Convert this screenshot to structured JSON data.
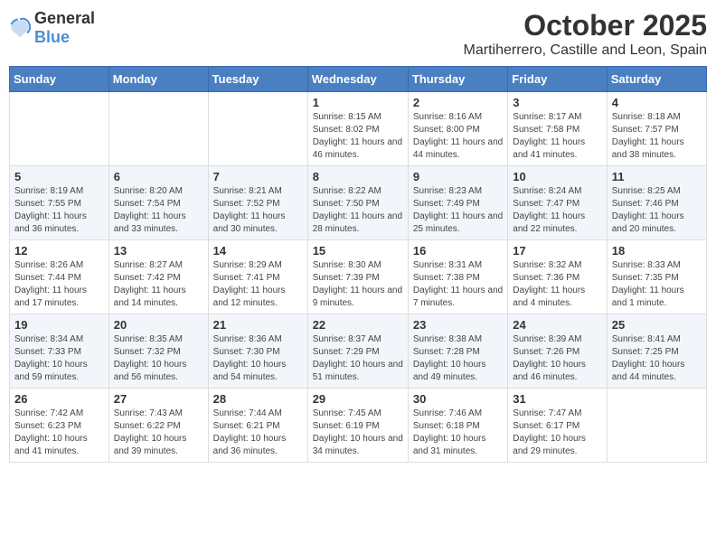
{
  "logo": {
    "general": "General",
    "blue": "Blue"
  },
  "header": {
    "month": "October 2025",
    "location": "Martiherrero, Castille and Leon, Spain"
  },
  "weekdays": [
    "Sunday",
    "Monday",
    "Tuesday",
    "Wednesday",
    "Thursday",
    "Friday",
    "Saturday"
  ],
  "weeks": [
    [
      {
        "day": "",
        "info": ""
      },
      {
        "day": "",
        "info": ""
      },
      {
        "day": "",
        "info": ""
      },
      {
        "day": "1",
        "info": "Sunrise: 8:15 AM\nSunset: 8:02 PM\nDaylight: 11 hours and 46 minutes."
      },
      {
        "day": "2",
        "info": "Sunrise: 8:16 AM\nSunset: 8:00 PM\nDaylight: 11 hours and 44 minutes."
      },
      {
        "day": "3",
        "info": "Sunrise: 8:17 AM\nSunset: 7:58 PM\nDaylight: 11 hours and 41 minutes."
      },
      {
        "day": "4",
        "info": "Sunrise: 8:18 AM\nSunset: 7:57 PM\nDaylight: 11 hours and 38 minutes."
      }
    ],
    [
      {
        "day": "5",
        "info": "Sunrise: 8:19 AM\nSunset: 7:55 PM\nDaylight: 11 hours and 36 minutes."
      },
      {
        "day": "6",
        "info": "Sunrise: 8:20 AM\nSunset: 7:54 PM\nDaylight: 11 hours and 33 minutes."
      },
      {
        "day": "7",
        "info": "Sunrise: 8:21 AM\nSunset: 7:52 PM\nDaylight: 11 hours and 30 minutes."
      },
      {
        "day": "8",
        "info": "Sunrise: 8:22 AM\nSunset: 7:50 PM\nDaylight: 11 hours and 28 minutes."
      },
      {
        "day": "9",
        "info": "Sunrise: 8:23 AM\nSunset: 7:49 PM\nDaylight: 11 hours and 25 minutes."
      },
      {
        "day": "10",
        "info": "Sunrise: 8:24 AM\nSunset: 7:47 PM\nDaylight: 11 hours and 22 minutes."
      },
      {
        "day": "11",
        "info": "Sunrise: 8:25 AM\nSunset: 7:46 PM\nDaylight: 11 hours and 20 minutes."
      }
    ],
    [
      {
        "day": "12",
        "info": "Sunrise: 8:26 AM\nSunset: 7:44 PM\nDaylight: 11 hours and 17 minutes."
      },
      {
        "day": "13",
        "info": "Sunrise: 8:27 AM\nSunset: 7:42 PM\nDaylight: 11 hours and 14 minutes."
      },
      {
        "day": "14",
        "info": "Sunrise: 8:29 AM\nSunset: 7:41 PM\nDaylight: 11 hours and 12 minutes."
      },
      {
        "day": "15",
        "info": "Sunrise: 8:30 AM\nSunset: 7:39 PM\nDaylight: 11 hours and 9 minutes."
      },
      {
        "day": "16",
        "info": "Sunrise: 8:31 AM\nSunset: 7:38 PM\nDaylight: 11 hours and 7 minutes."
      },
      {
        "day": "17",
        "info": "Sunrise: 8:32 AM\nSunset: 7:36 PM\nDaylight: 11 hours and 4 minutes."
      },
      {
        "day": "18",
        "info": "Sunrise: 8:33 AM\nSunset: 7:35 PM\nDaylight: 11 hours and 1 minute."
      }
    ],
    [
      {
        "day": "19",
        "info": "Sunrise: 8:34 AM\nSunset: 7:33 PM\nDaylight: 10 hours and 59 minutes."
      },
      {
        "day": "20",
        "info": "Sunrise: 8:35 AM\nSunset: 7:32 PM\nDaylight: 10 hours and 56 minutes."
      },
      {
        "day": "21",
        "info": "Sunrise: 8:36 AM\nSunset: 7:30 PM\nDaylight: 10 hours and 54 minutes."
      },
      {
        "day": "22",
        "info": "Sunrise: 8:37 AM\nSunset: 7:29 PM\nDaylight: 10 hours and 51 minutes."
      },
      {
        "day": "23",
        "info": "Sunrise: 8:38 AM\nSunset: 7:28 PM\nDaylight: 10 hours and 49 minutes."
      },
      {
        "day": "24",
        "info": "Sunrise: 8:39 AM\nSunset: 7:26 PM\nDaylight: 10 hours and 46 minutes."
      },
      {
        "day": "25",
        "info": "Sunrise: 8:41 AM\nSunset: 7:25 PM\nDaylight: 10 hours and 44 minutes."
      }
    ],
    [
      {
        "day": "26",
        "info": "Sunrise: 7:42 AM\nSunset: 6:23 PM\nDaylight: 10 hours and 41 minutes."
      },
      {
        "day": "27",
        "info": "Sunrise: 7:43 AM\nSunset: 6:22 PM\nDaylight: 10 hours and 39 minutes."
      },
      {
        "day": "28",
        "info": "Sunrise: 7:44 AM\nSunset: 6:21 PM\nDaylight: 10 hours and 36 minutes."
      },
      {
        "day": "29",
        "info": "Sunrise: 7:45 AM\nSunset: 6:19 PM\nDaylight: 10 hours and 34 minutes."
      },
      {
        "day": "30",
        "info": "Sunrise: 7:46 AM\nSunset: 6:18 PM\nDaylight: 10 hours and 31 minutes."
      },
      {
        "day": "31",
        "info": "Sunrise: 7:47 AM\nSunset: 6:17 PM\nDaylight: 10 hours and 29 minutes."
      },
      {
        "day": "",
        "info": ""
      }
    ]
  ]
}
